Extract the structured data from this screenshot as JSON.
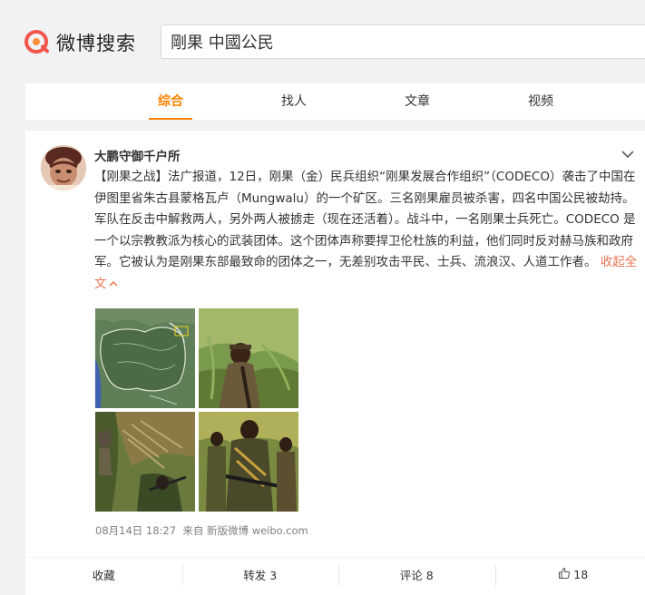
{
  "brand": {
    "name": "微博搜索",
    "accent": "#ff8200",
    "logo_color": "#f0574c"
  },
  "search": {
    "value": "剛果 中國公民"
  },
  "tabs": [
    {
      "label": "综合",
      "active": true
    },
    {
      "label": "找人"
    },
    {
      "label": "文章"
    },
    {
      "label": "视频"
    }
  ],
  "post": {
    "author": "大鹏守御千户所",
    "text": "【刚果之战】法广报道，12日，刚果（金）民兵组织“刚果发展合作组织”（CODECO）袭击了中国在伊图里省朱古县蒙格瓦卢（Mungwalu）的一个矿区。三名刚果雇员被杀害，四名中国公民被劫持。军队在反击中解救两人，另外两人被掳走（现在还活着）。战斗中，一名刚果士兵死亡。CODECO 是一个以宗教教派为核心的武装团体。这个团体声称要捍卫伦杜族的利益，他们同时反对赫马族和政府军。它被认为是刚果东部最致命的团体之一，无差别攻击平民、士兵、流浪汉、人道工作者。",
    "collapse_label": "收起全文",
    "timestamp": "08月14日 18:27",
    "source": "来自 新版微博 weibo.com",
    "images": [
      {
        "name": "map-image"
      },
      {
        "name": "soldier-image"
      },
      {
        "name": "hillside-image"
      },
      {
        "name": "militia-image"
      }
    ]
  },
  "actions": [
    {
      "label": "收藏"
    },
    {
      "label": "转发 3"
    },
    {
      "label": "评论 8"
    },
    {
      "label": "18",
      "icon": "thumbs-up-icon"
    }
  ]
}
